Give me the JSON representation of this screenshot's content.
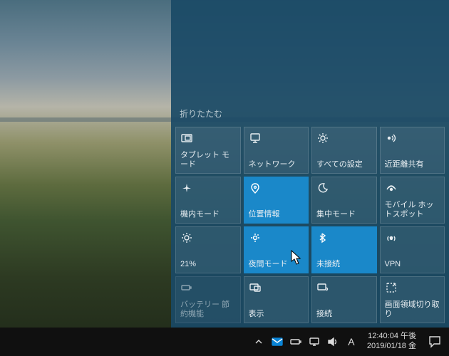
{
  "action_center": {
    "collapse_label": "折りたたむ",
    "tiles": [
      {
        "id": "tablet-mode",
        "icon": "tablet-icon",
        "label": "タブレット モード",
        "state": "off"
      },
      {
        "id": "network",
        "icon": "network-icon",
        "label": "ネットワーク",
        "state": "off"
      },
      {
        "id": "all-settings",
        "icon": "gear-icon",
        "label": "すべての設定",
        "state": "off"
      },
      {
        "id": "nearby-share",
        "icon": "nearby-icon",
        "label": "近距離共有",
        "state": "off"
      },
      {
        "id": "airplane-mode",
        "icon": "airplane-icon",
        "label": "機内モード",
        "state": "off"
      },
      {
        "id": "location",
        "icon": "location-icon",
        "label": "位置情報",
        "state": "on"
      },
      {
        "id": "focus-assist",
        "icon": "moon-icon",
        "label": "集中モード",
        "state": "off"
      },
      {
        "id": "mobile-hotspot",
        "icon": "hotspot-icon",
        "label": "モバイル ホットスポット",
        "state": "off"
      },
      {
        "id": "brightness",
        "icon": "sun-icon",
        "label": "21%",
        "state": "off"
      },
      {
        "id": "night-light",
        "icon": "night-icon",
        "label": "夜間モード",
        "state": "on"
      },
      {
        "id": "bluetooth",
        "icon": "bluetooth-icon",
        "label": "未接続",
        "state": "on"
      },
      {
        "id": "vpn",
        "icon": "vpn-icon",
        "label": "VPN",
        "state": "off"
      },
      {
        "id": "battery-saver",
        "icon": "battery-icon",
        "label": "バッテリー\n節約機能",
        "state": "disabled"
      },
      {
        "id": "project",
        "icon": "project-icon",
        "label": "表示",
        "state": "off"
      },
      {
        "id": "connect",
        "icon": "connect-icon",
        "label": "接続",
        "state": "off"
      },
      {
        "id": "screen-snip",
        "icon": "snip-icon",
        "label": "画面領域切り取り",
        "state": "off"
      }
    ]
  },
  "taskbar": {
    "ime_label": "A",
    "time": "12:40:04 午後",
    "date": "2019/01/18 金"
  }
}
